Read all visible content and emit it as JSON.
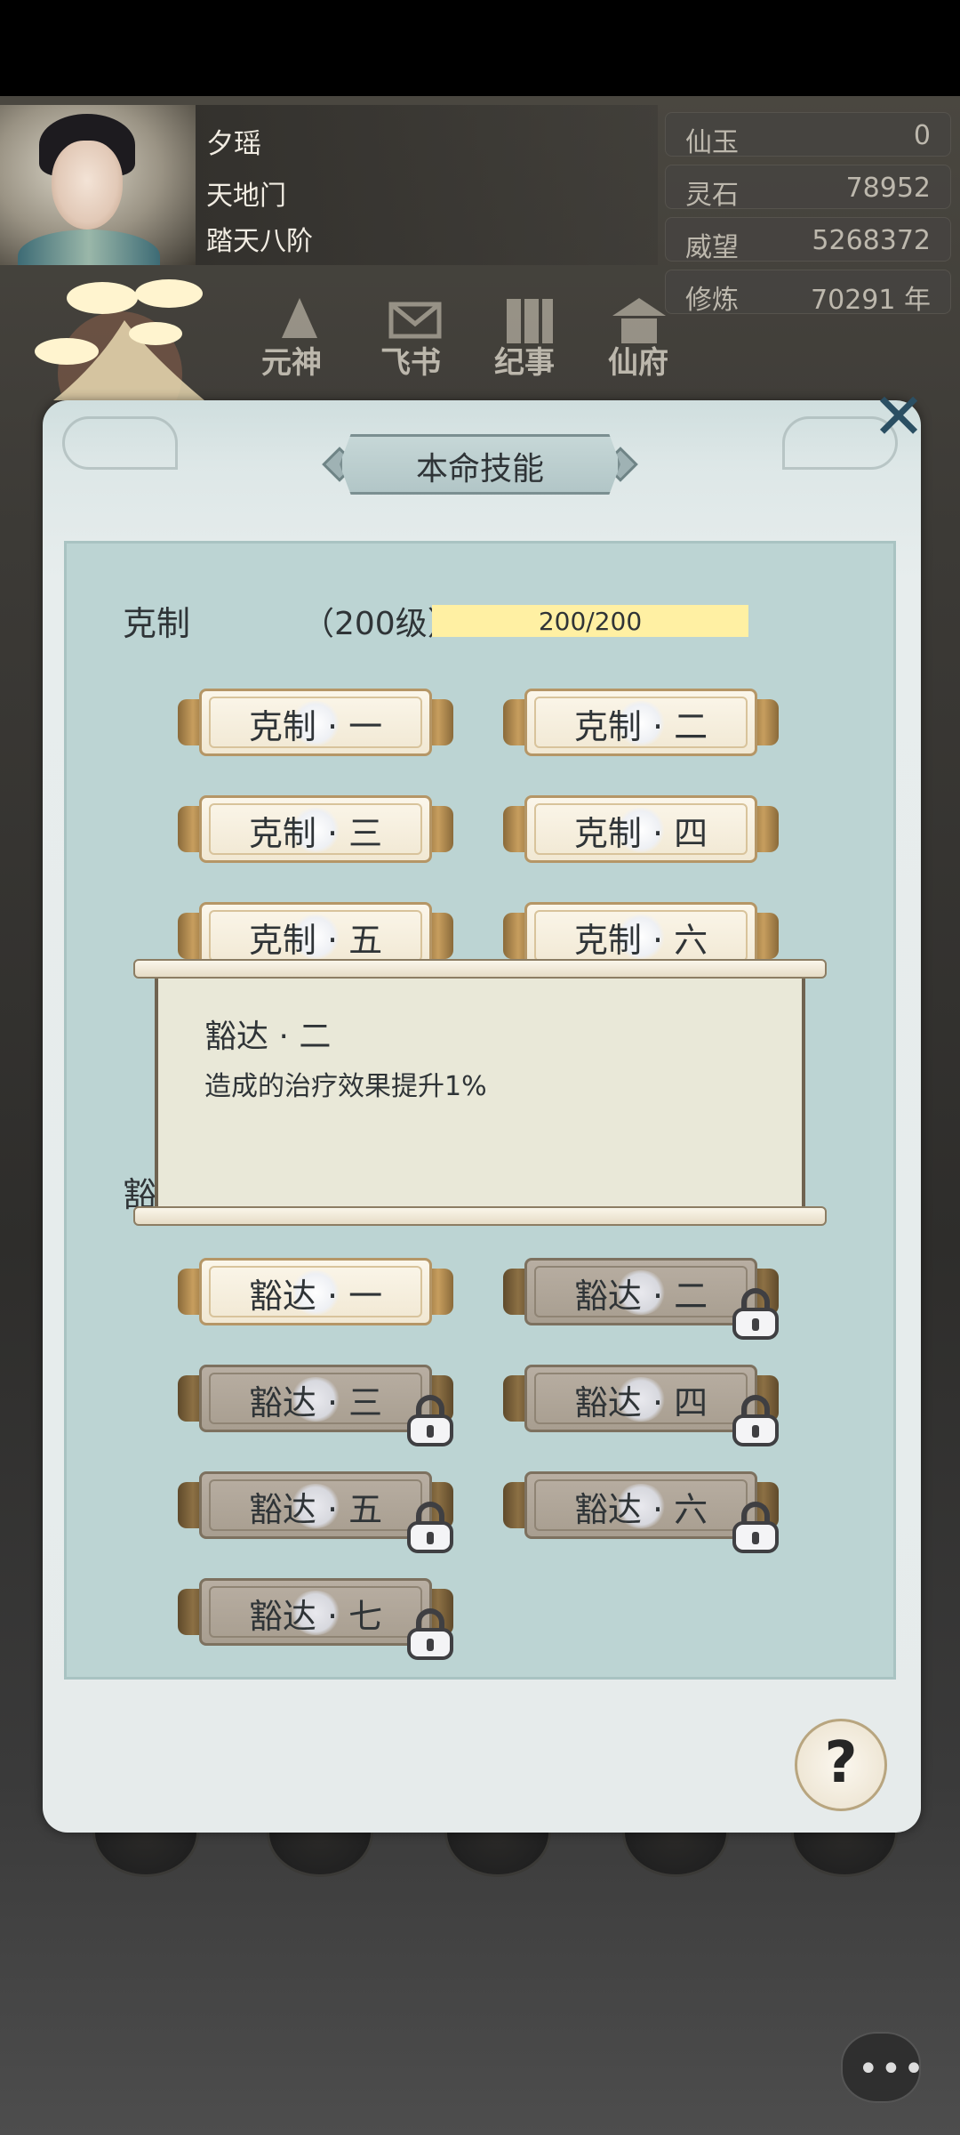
{
  "player": {
    "name": "夕瑶",
    "sect": "天地门",
    "realm": "踏天八阶"
  },
  "stats": [
    {
      "label": "仙玉",
      "value": "0"
    },
    {
      "label": "灵石",
      "value": "78952"
    },
    {
      "label": "威望",
      "value": "5268372"
    },
    {
      "label": "修炼",
      "value": "70291 年"
    }
  ],
  "nav": {
    "items": [
      "元神",
      "飞书",
      "纪事",
      "仙府"
    ]
  },
  "modal": {
    "title": "本命技能"
  },
  "group1": {
    "label": "克制",
    "level_text": "（200级）",
    "progress_text": "200/200",
    "progress_fraction": 1.0,
    "skills": [
      "克制 · 一",
      "克制 · 二",
      "克制 · 三",
      "克制 · 四",
      "克制 · 五",
      "克制 · 六"
    ]
  },
  "group2": {
    "label_partial": "豁",
    "skills": [
      {
        "label": "豁达 · 一",
        "locked": false
      },
      {
        "label": "豁达 · 二",
        "locked": true
      },
      {
        "label": "豁达 · 三",
        "locked": true
      },
      {
        "label": "豁达 · 四",
        "locked": true
      },
      {
        "label": "豁达 · 五",
        "locked": true
      },
      {
        "label": "豁达 · 六",
        "locked": true
      },
      {
        "label": "豁达 · 七",
        "locked": true
      }
    ]
  },
  "tooltip": {
    "title": "豁达 · 二",
    "description": "造成的治疗效果提升1%"
  },
  "icons": {
    "close": "close-icon",
    "help": "help-icon",
    "lock": "lock-icon",
    "chat": "chat-icon"
  },
  "colors": {
    "progress_fill": "#fff0a3",
    "close_x": "#2b4f63"
  }
}
